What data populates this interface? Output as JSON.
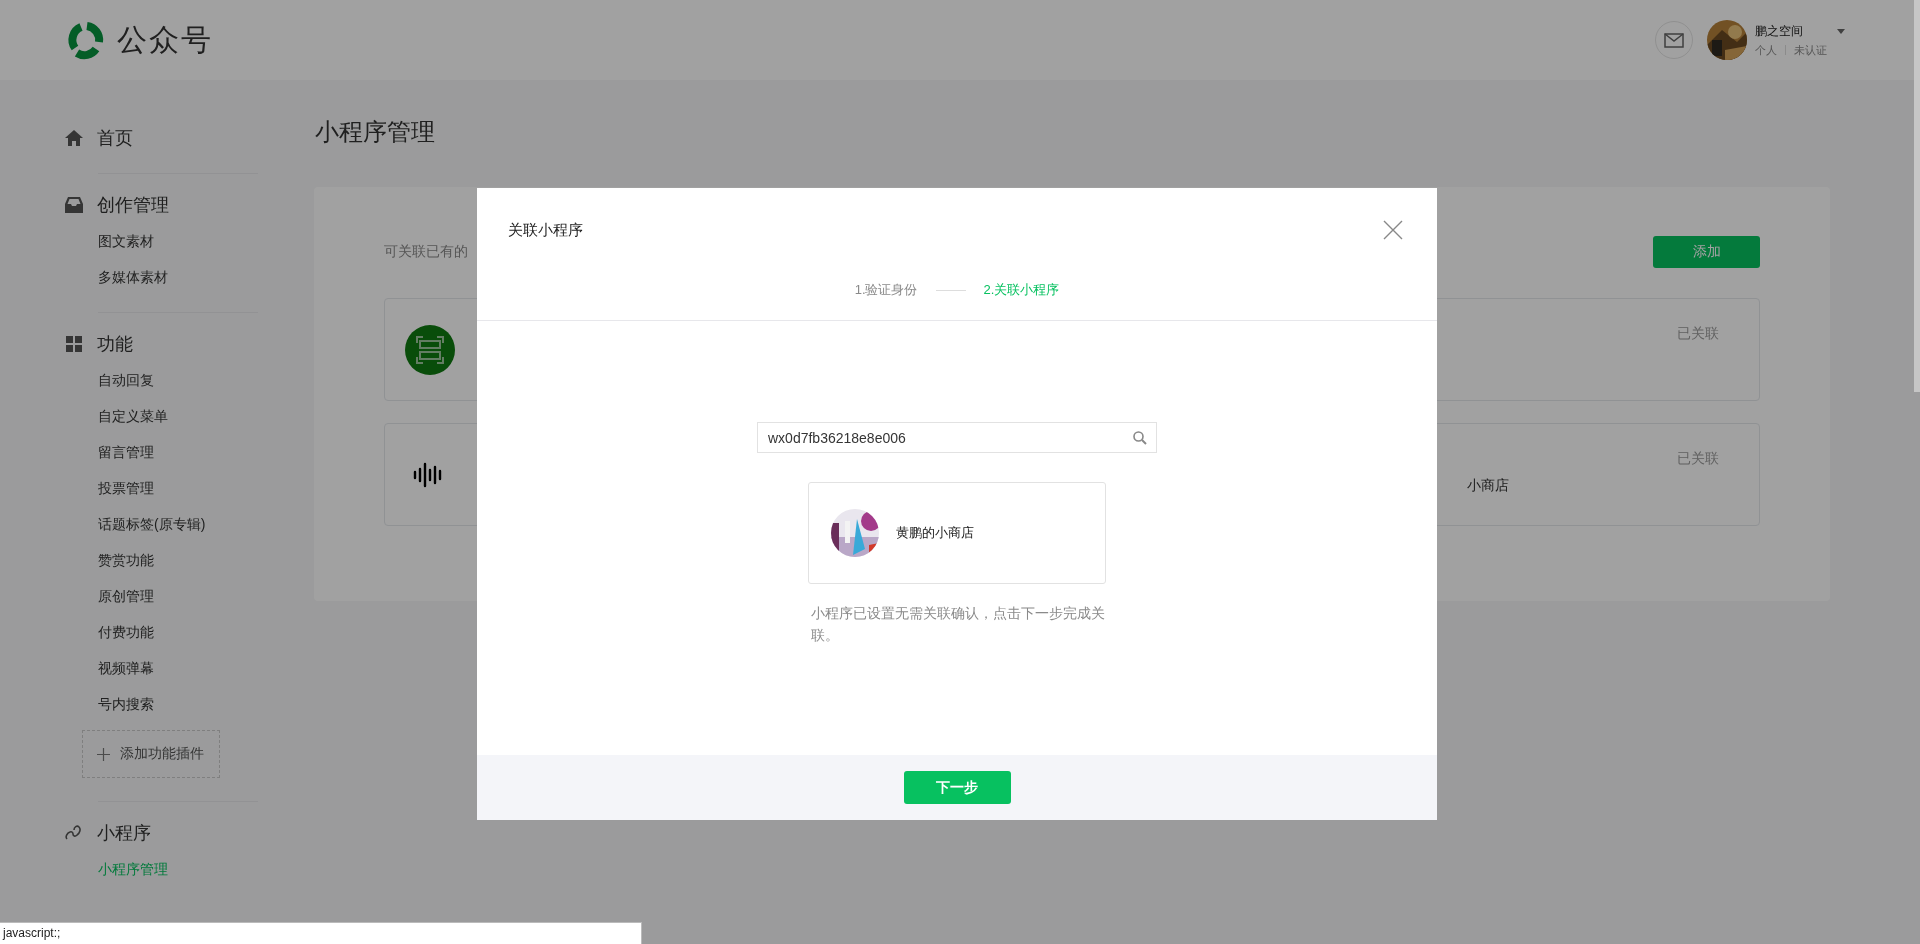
{
  "header": {
    "logo_text": "公众号",
    "account": {
      "name": "鹏之空间",
      "type": "个人",
      "status": "未认证"
    }
  },
  "sidebar": {
    "sections": [
      {
        "title": "首页"
      },
      {
        "title": "创作管理",
        "items": [
          {
            "label": "图文素材",
            "selected": false
          },
          {
            "label": "多媒体素材",
            "selected": false
          }
        ]
      },
      {
        "title": "功能",
        "items": [
          {
            "label": "自动回复",
            "selected": false
          },
          {
            "label": "自定义菜单",
            "selected": false
          },
          {
            "label": "留言管理",
            "selected": false
          },
          {
            "label": "投票管理",
            "selected": false
          },
          {
            "label": "话题标签(原专辑)",
            "selected": false
          },
          {
            "label": "赞赏功能",
            "selected": false
          },
          {
            "label": "原创管理",
            "selected": false
          },
          {
            "label": "付费功能",
            "selected": false
          },
          {
            "label": "视频弹幕",
            "selected": false
          },
          {
            "label": "号内搜索",
            "selected": false
          }
        ],
        "add_button": "添加功能插件"
      },
      {
        "title": "小程序",
        "items": [
          {
            "label": "小程序管理",
            "selected": true
          }
        ]
      }
    ]
  },
  "main": {
    "title": "小程序管理",
    "description": "可关联已有的",
    "add_button": "添加",
    "cards": [
      {
        "status": "已关联"
      },
      {
        "status": "已关联",
        "name": "小商店"
      }
    ]
  },
  "modal": {
    "title": "关联小程序",
    "steps": [
      {
        "label": "1.验证身份",
        "selected": false
      },
      {
        "label": "2.关联小程序",
        "selected": true
      }
    ],
    "search": {
      "value": "wx0d7fb36218e8e006"
    },
    "result": {
      "name": "黄鹏的小商店"
    },
    "hint": "小程序已设置无需关联确认，点击下一步完成关联。",
    "next_button": "下一步"
  },
  "status_bar": {
    "text": "javascript:;"
  }
}
